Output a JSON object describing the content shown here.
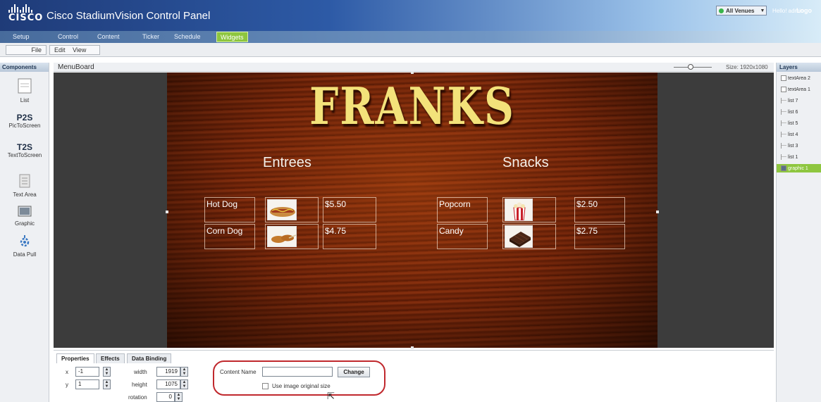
{
  "header": {
    "brand": "CISCO",
    "app_title": "Cisco StadiumVision Control Panel",
    "venue_select": "All Venues",
    "greeting": "Hello! admin",
    "logout": "Logo"
  },
  "nav": {
    "items": [
      "Setup",
      "Control",
      "Content",
      "Ticker",
      "Schedule",
      "Widgets"
    ],
    "active": "Widgets"
  },
  "menubar": {
    "file": "File",
    "edit": "Edit",
    "view": "View"
  },
  "components": {
    "title": "Components",
    "items": [
      {
        "label": "List",
        "icon": "list-icon"
      },
      {
        "label": "PicToScreen",
        "big": "P2S"
      },
      {
        "label": "TextToScreen",
        "big": "T2S"
      },
      {
        "label": "Text Area",
        "icon": "text-area-icon"
      },
      {
        "label": "Graphic",
        "icon": "graphic-icon"
      },
      {
        "label": "Data Pull",
        "icon": "data-pull-icon"
      }
    ]
  },
  "editor": {
    "doc_title": "MenuBoard",
    "size_label": "Size: 1920x1080"
  },
  "board": {
    "title": "FRANKS",
    "entrees_heading": "Entrees",
    "snacks_heading": "Snacks",
    "entrees": [
      {
        "name": "Hot Dog",
        "price": "$5.50",
        "thumb": "hot-dog-image"
      },
      {
        "name": "Corn Dog",
        "price": "$4.75",
        "thumb": "corn-dog-image"
      }
    ],
    "snacks": [
      {
        "name": "Popcorn",
        "price": "$2.50",
        "thumb": "popcorn-image"
      },
      {
        "name": "Candy",
        "price": "$2.75",
        "thumb": "candy-image"
      }
    ]
  },
  "layers": {
    "title": "Layers",
    "items": [
      "textArea 2",
      "textArea 1",
      "list 7",
      "list 6",
      "list 5",
      "list 4",
      "list 3",
      "list 1",
      "graphic 1"
    ],
    "selected": "graphic 1"
  },
  "properties": {
    "tabs": [
      "Properties",
      "Effects",
      "Data Binding"
    ],
    "active_tab": "Properties",
    "x_label": "x",
    "x_value": "-1",
    "y_label": "y",
    "y_value": "1",
    "width_label": "width",
    "width_value": "1919",
    "height_label": "height",
    "height_value": "1075",
    "rotation_label": "rotation",
    "rotation_value": "0",
    "content_name_label": "Content Name",
    "content_name_value": "",
    "change_button": "Change",
    "use_original_size_label": "Use image original size",
    "use_original_size_checked": false
  },
  "colors": {
    "accent_green": "#8ec63f",
    "highlight_red": "#c0282d",
    "header_blue": "#2d5aa6"
  }
}
